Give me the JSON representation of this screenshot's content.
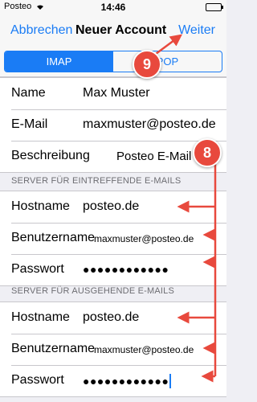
{
  "statusbar": {
    "carrier": "Posteo",
    "time": "14:46"
  },
  "navbar": {
    "cancel": "Abbrechen",
    "title": "Neuer Account",
    "next": "Weiter"
  },
  "segments": {
    "imap": "IMAP",
    "pop": "POP"
  },
  "account": {
    "name_label": "Name",
    "name_value": "Max Muster",
    "email_label": "E-Mail",
    "email_value": "maxmuster@posteo.de",
    "desc_label": "Beschreibung",
    "desc_value": "Posteo E-Mail"
  },
  "incoming": {
    "header": "SERVER FÜR EINTREFFENDE E-MAILS",
    "host_label": "Hostname",
    "host_value": "posteo.de",
    "user_label": "Benutzername",
    "user_value": "maxmuster@posteo.de",
    "pw_label": "Passwort",
    "pw_value": "●●●●●●●●●●●●"
  },
  "outgoing": {
    "header": "SERVER FÜR AUSGEHENDE E-MAILS",
    "host_label": "Hostname",
    "host_value": "posteo.de",
    "user_label": "Benutzername",
    "user_value": "maxmuster@posteo.de",
    "pw_label": "Passwort",
    "pw_value": "●●●●●●●●●●●●"
  },
  "annotations": {
    "badge_next": "9",
    "badge_fields": "8",
    "color": "#e8493d"
  },
  "colors": {
    "accent": "#1a7cf5",
    "background": "#efeff4"
  }
}
